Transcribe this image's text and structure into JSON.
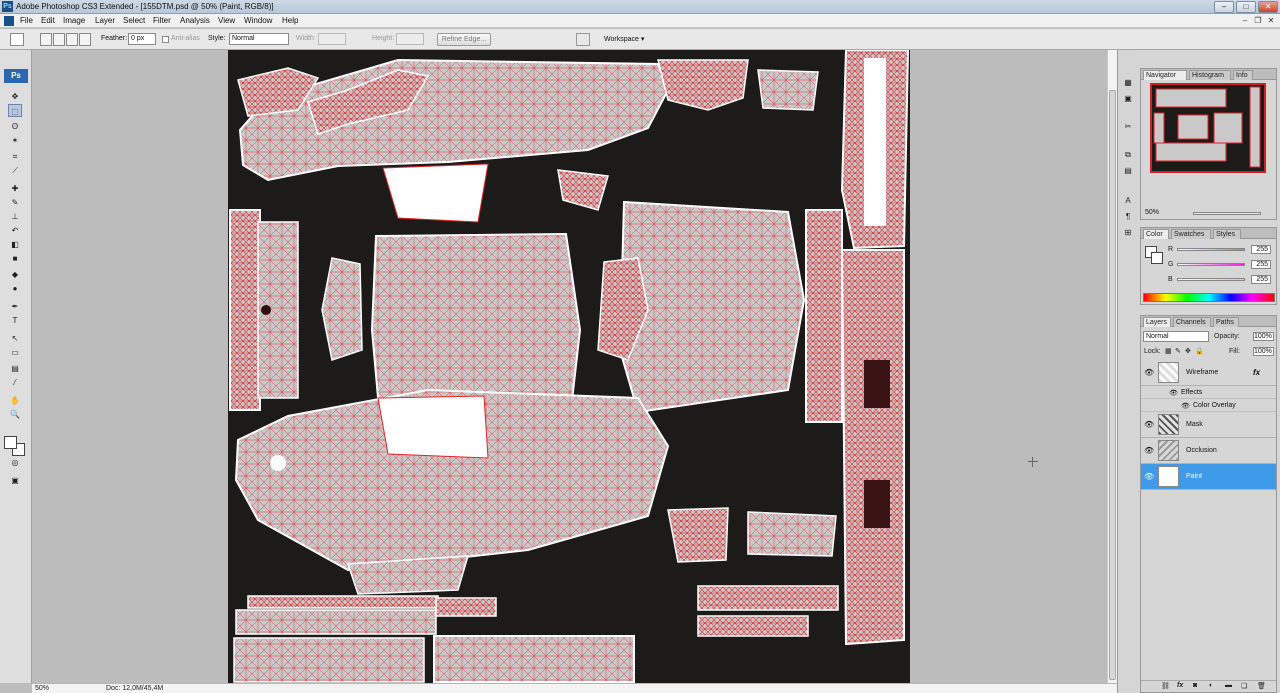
{
  "window": {
    "title": "Adobe Photoshop CS3 Extended - [155DTM.psd @ 50% (Paint, RGB/8)]",
    "app_icon": "Ps",
    "minimize": "–",
    "maximize": "□",
    "close": "✕"
  },
  "menubar": {
    "items": [
      "File",
      "Edit",
      "Image",
      "Layer",
      "Select",
      "Filter",
      "Analysis",
      "View",
      "Window",
      "Help"
    ],
    "doc_minimize": "–",
    "doc_restore": "❐",
    "doc_close": "✕"
  },
  "options_bar": {
    "feather_label": "Feather:",
    "feather_value": "0 px",
    "antialias_label": "Anti-alias",
    "style_label": "Style:",
    "style_value": "Normal",
    "width_label": "Width:",
    "height_label": "Height:",
    "refine_edge": "Refine Edge...",
    "workspace": "Workspace ▾"
  },
  "toolbox": {
    "logo": "Ps",
    "tools": [
      "move-tool",
      "marquee-tool",
      "lasso-tool",
      "magic-wand-tool",
      "crop-tool",
      "slice-tool",
      "healing-tool",
      "brush-tool",
      "stamp-tool",
      "history-brush-tool",
      "eraser-tool",
      "gradient-tool",
      "blur-tool",
      "dodge-tool",
      "pen-tool",
      "type-tool",
      "path-select-tool",
      "shape-tool",
      "notes-tool",
      "eyedropper-tool",
      "hand-tool",
      "zoom-tool"
    ],
    "glyphs": [
      "✥",
      "⬚",
      "ʘ",
      "✶",
      "⌗",
      "⟋",
      "✚",
      "✎",
      "⊥",
      "↶",
      "◧",
      "■",
      "◆",
      "●",
      "✒",
      "T",
      "↖",
      "▭",
      "▤",
      "⁄",
      "✋",
      "🔍"
    ],
    "foreground_color": "#ffffff",
    "background_color": "#ffffff"
  },
  "status_bar": {
    "zoom": "50%",
    "doc_info": "Doc: 12,0M/45,4M"
  },
  "navigator_panel": {
    "tabs": [
      "Navigator",
      "Histogram",
      "Info"
    ],
    "zoom": "50%"
  },
  "color_panel": {
    "tabs": [
      "Color",
      "Swatches",
      "Styles"
    ],
    "channels": [
      {
        "label": "R",
        "value": "255",
        "color": "#00c8c8"
      },
      {
        "label": "G",
        "value": "255",
        "color": "#e020e0"
      },
      {
        "label": "B",
        "value": "255",
        "color": "#e0e020"
      }
    ]
  },
  "layers_panel": {
    "tabs": [
      "Layers",
      "Channels",
      "Paths"
    ],
    "blend_mode": "Normal",
    "opacity_label": "Opacity:",
    "opacity_value": "100%",
    "lock_label": "Lock:",
    "fill_label": "Fill:",
    "fill_value": "100%",
    "fx": "fx",
    "effects_label": "Effects",
    "color_overlay_label": "Color Overlay",
    "layers": [
      {
        "name": "Wireframe",
        "selected": false
      },
      {
        "name": "Mask",
        "selected": false
      },
      {
        "name": "Occlusion",
        "selected": false
      },
      {
        "name": "Paint",
        "selected": true
      }
    ],
    "footer_icons": [
      "link-icon",
      "fx-icon",
      "mask-icon",
      "adjustment-icon",
      "folder-icon",
      "new-layer-icon",
      "trash-icon"
    ]
  },
  "colors": {
    "wire_red": "#e0242a",
    "panel_fill": "#c9c9c9",
    "canvas_bg": "#1d1a1a",
    "selection_blue": "#3d9be9"
  }
}
